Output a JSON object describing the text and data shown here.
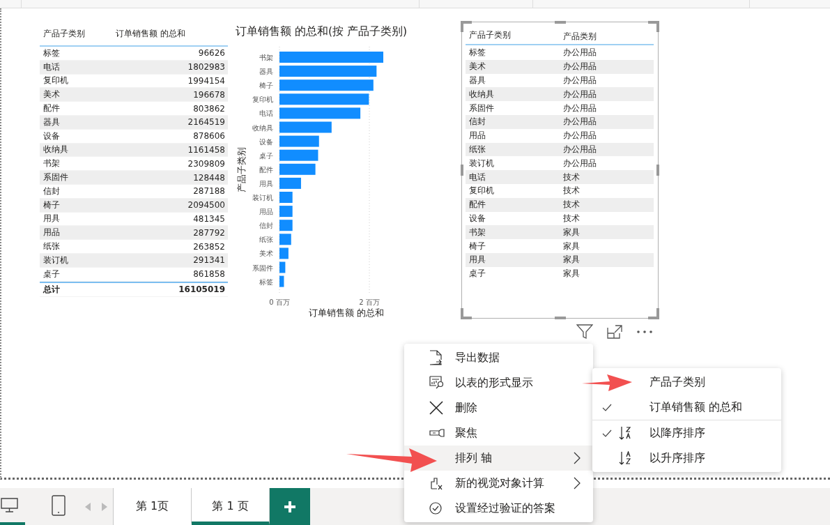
{
  "sales_table": {
    "columns": [
      "产品子类别",
      "订单销售额 的总和"
    ],
    "rows": [
      {
        "subcategory": "标签",
        "sales": "96626"
      },
      {
        "subcategory": "电话",
        "sales": "1802983"
      },
      {
        "subcategory": "复印机",
        "sales": "1994154"
      },
      {
        "subcategory": "美术",
        "sales": "196678"
      },
      {
        "subcategory": "配件",
        "sales": "803862"
      },
      {
        "subcategory": "器具",
        "sales": "2164519"
      },
      {
        "subcategory": "设备",
        "sales": "878606"
      },
      {
        "subcategory": "收纳具",
        "sales": "1161458"
      },
      {
        "subcategory": "书架",
        "sales": "2309809"
      },
      {
        "subcategory": "系固件",
        "sales": "128448"
      },
      {
        "subcategory": "信封",
        "sales": "287188"
      },
      {
        "subcategory": "椅子",
        "sales": "2094500"
      },
      {
        "subcategory": "用具",
        "sales": "481345"
      },
      {
        "subcategory": "用品",
        "sales": "287792"
      },
      {
        "subcategory": "纸张",
        "sales": "263852"
      },
      {
        "subcategory": "装订机",
        "sales": "291341"
      },
      {
        "subcategory": "桌子",
        "sales": "861858"
      }
    ],
    "total": {
      "label": "总计",
      "value": "16105019"
    }
  },
  "bar_chart": {
    "chart_data": {
      "type": "bar",
      "orientation": "horizontal",
      "title": "订单销售额 的总和(按 产品子类别)",
      "xlabel": "订单销售额 的总和",
      "ylabel": "产品子类别",
      "categories": [
        "书架",
        "器具",
        "椅子",
        "复印机",
        "电话",
        "收纳具",
        "设备",
        "桌子",
        "配件",
        "用具",
        "装订机",
        "用品",
        "信封",
        "纸张",
        "美术",
        "系固件",
        "标签"
      ],
      "values": [
        2.31,
        2.16,
        2.09,
        1.99,
        1.8,
        1.16,
        0.88,
        0.86,
        0.8,
        0.48,
        0.29,
        0.29,
        0.29,
        0.26,
        0.2,
        0.13,
        0.1
      ],
      "xlim": [
        0,
        2.31
      ],
      "xticks": [
        {
          "value": 0,
          "label": "0 百万"
        },
        {
          "value": 2,
          "label": "2 百万"
        }
      ]
    }
  },
  "category_table": {
    "columns": [
      {
        "label": "产品子类别",
        "sorted": false
      },
      {
        "label": "产品类别",
        "sorted": true
      }
    ],
    "rows": [
      [
        "标签",
        "办公用品"
      ],
      [
        "美术",
        "办公用品"
      ],
      [
        "器具",
        "办公用品"
      ],
      [
        "收纳具",
        "办公用品"
      ],
      [
        "系固件",
        "办公用品"
      ],
      [
        "信封",
        "办公用品"
      ],
      [
        "用品",
        "办公用品"
      ],
      [
        "纸张",
        "办公用品"
      ],
      [
        "装订机",
        "办公用品"
      ],
      [
        "电话",
        "技术"
      ],
      [
        "复印机",
        "技术"
      ],
      [
        "配件",
        "技术"
      ],
      [
        "设备",
        "技术"
      ],
      [
        "书架",
        "家具"
      ],
      [
        "椅子",
        "家具"
      ],
      [
        "用具",
        "家具"
      ],
      [
        "桌子",
        "家具"
      ]
    ]
  },
  "context_menu": {
    "items": [
      {
        "kind": "export",
        "label": "导出数据",
        "has_submenu": false,
        "highlighted": false
      },
      {
        "kind": "table",
        "label": "以表的形式显示",
        "has_submenu": false,
        "highlighted": false
      },
      {
        "kind": "delete",
        "label": "删除",
        "has_submenu": false,
        "highlighted": false
      },
      {
        "kind": "focus",
        "label": "聚焦",
        "has_submenu": false,
        "highlighted": false
      },
      {
        "kind": "sort",
        "label": "排列 轴",
        "has_submenu": true,
        "highlighted": true
      },
      {
        "kind": "calc",
        "label": "新的视觉对象计算",
        "has_submenu": true,
        "highlighted": false
      },
      {
        "kind": "verify",
        "label": "设置经过验证的答案",
        "has_submenu": false,
        "highlighted": false
      }
    ]
  },
  "submenu": {
    "sort_fields": [
      {
        "label": "产品子类别",
        "checked": false
      },
      {
        "label": "订单销售额 的总和",
        "checked": true
      }
    ],
    "sort_orders": [
      {
        "kind": "descending",
        "label": "以降序排序",
        "checked": true
      },
      {
        "kind": "ascending",
        "label": "以升序排序",
        "checked": false
      }
    ]
  },
  "views": [
    {
      "kind": "desktop",
      "selected": true
    },
    {
      "kind": "phone",
      "selected": false
    }
  ],
  "page_tabs": [
    {
      "label": "第 1页",
      "selected": false
    },
    {
      "label": "第 1 页",
      "selected": true
    }
  ]
}
